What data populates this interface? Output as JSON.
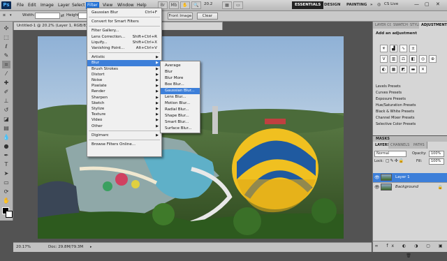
{
  "menubar": {
    "logo": "Ps",
    "items": [
      "File",
      "Edit",
      "Image",
      "Layer",
      "Select",
      "Filter",
      "View",
      "Window",
      "Help"
    ],
    "active_item": "Filter",
    "zoom_value": "20.2",
    "workspaces": [
      "ESSENTIALS",
      "DESIGN",
      "PAINTING"
    ],
    "workspace_more": "»",
    "cs_live": "CS Live"
  },
  "options": {
    "width_label": "Width:",
    "height_label": "Height:",
    "front_image": "Front Image",
    "clear": "Clear"
  },
  "document": {
    "tab_title": "Untitled-1 @ 20.2% (Layer 1, RGB/8) *",
    "zoom": "20.17%",
    "doc_size": "Doc: 29.8M/79.3M"
  },
  "filter_menu": {
    "items": [
      {
        "label": "Gaussian Blur",
        "shortcut": "Ctrl+F"
      },
      {
        "sep": true
      },
      {
        "label": "Convert for Smart Filters"
      },
      {
        "sep": true
      },
      {
        "label": "Filter Gallery..."
      },
      {
        "label": "Lens Correction...",
        "shortcut": "Shift+Ctrl+R"
      },
      {
        "label": "Liquify...",
        "shortcut": "Shift+Ctrl+X"
      },
      {
        "label": "Vanishing Point...",
        "shortcut": "Alt+Ctrl+V"
      },
      {
        "sep": true
      },
      {
        "label": "Artistic",
        "sub": true
      },
      {
        "label": "Blur",
        "sub": true,
        "selected": true
      },
      {
        "label": "Brush Strokes",
        "sub": true
      },
      {
        "label": "Distort",
        "sub": true
      },
      {
        "label": "Noise",
        "sub": true
      },
      {
        "label": "Pixelate",
        "sub": true
      },
      {
        "label": "Render",
        "sub": true
      },
      {
        "label": "Sharpen",
        "sub": true
      },
      {
        "label": "Sketch",
        "sub": true
      },
      {
        "label": "Stylize",
        "sub": true
      },
      {
        "label": "Texture",
        "sub": true
      },
      {
        "label": "Video",
        "sub": true
      },
      {
        "label": "Other",
        "sub": true
      },
      {
        "sep": true
      },
      {
        "label": "Digimarc",
        "sub": true
      },
      {
        "sep": true
      },
      {
        "label": "Browse Filters Online..."
      }
    ]
  },
  "blur_menu": {
    "items": [
      "Average",
      "Blur",
      "Blur More",
      "Box Blur...",
      "Gaussian Blur...",
      "Lens Blur...",
      "Motion Blur...",
      "Radial Blur...",
      "Shape Blur...",
      "Smart Blur...",
      "Surface Blur..."
    ],
    "selected": "Gaussian Blur..."
  },
  "adjustments_panel": {
    "tabs": [
      "LAYER COMPS",
      "SWATCHES",
      "STYLES",
      "ADJUSTMENTS"
    ],
    "title": "Add an adjustment",
    "presets": [
      "Levels Presets",
      "Curves Presets",
      "Exposure Presets",
      "Hue/Saturation Presets",
      "Black & White Presets",
      "Channel Mixer Presets",
      "Selective Color Presets"
    ]
  },
  "masks_label": "MASKS",
  "layers_panel": {
    "tabs": [
      "LAYERS",
      "CHANNELS",
      "PATHS"
    ],
    "blend_mode": "Normal",
    "opacity_label": "Opacity:",
    "opacity": "100%",
    "lock_label": "Lock:",
    "fill_label": "Fill:",
    "fill": "100%",
    "layers": [
      {
        "name": "Layer 1",
        "selected": true
      },
      {
        "name": "Background",
        "selected": false
      }
    ]
  },
  "colors": {
    "accent": "#3d7fd9",
    "menu_active": "#1a6dd6",
    "panel_bg": "#d6d6d6",
    "workspace_bg": "#535353"
  }
}
